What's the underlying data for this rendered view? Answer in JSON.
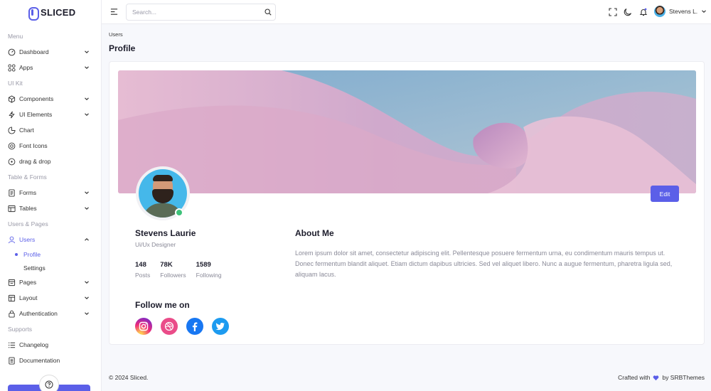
{
  "brand": {
    "name": "SLICED",
    "color": "#5b5fe8"
  },
  "sidebar": {
    "sections": [
      {
        "title": "Menu",
        "items": [
          {
            "label": "Dashboard",
            "icon": "dashboard-icon",
            "has_children": true
          },
          {
            "label": "Apps",
            "icon": "apps-icon",
            "has_children": true
          }
        ]
      },
      {
        "title": "UI Kit",
        "items": [
          {
            "label": "Components",
            "icon": "cube-icon",
            "has_children": true
          },
          {
            "label": "UI Elements",
            "icon": "bolt-icon",
            "has_children": true
          },
          {
            "label": "Chart",
            "icon": "chart-icon",
            "has_children": false
          },
          {
            "label": "Font Icons",
            "icon": "target-icon",
            "has_children": false
          },
          {
            "label": "drag & drop",
            "icon": "drag-icon",
            "has_children": false
          }
        ]
      },
      {
        "title": "Table & Forms",
        "items": [
          {
            "label": "Forms",
            "icon": "form-icon",
            "has_children": true
          },
          {
            "label": "Tables",
            "icon": "table-icon",
            "has_children": true
          }
        ]
      },
      {
        "title": "Users & Pages",
        "items": [
          {
            "label": "Users",
            "icon": "user-icon",
            "has_children": true,
            "expanded": true,
            "children": [
              {
                "label": "Profile",
                "active": true
              },
              {
                "label": "Settings",
                "active": false
              }
            ]
          },
          {
            "label": "Pages",
            "icon": "pages-icon",
            "has_children": true
          },
          {
            "label": "Layout",
            "icon": "layout-icon",
            "has_children": true
          },
          {
            "label": "Authentication",
            "icon": "lock-icon",
            "has_children": true
          }
        ]
      },
      {
        "title": "Supports",
        "items": [
          {
            "label": "Changelog",
            "icon": "list-icon",
            "has_children": false
          },
          {
            "label": "Documentation",
            "icon": "doc-icon",
            "has_children": false
          }
        ]
      }
    ]
  },
  "topbar": {
    "search_placeholder": "Search...",
    "user_name": "Stevens L."
  },
  "page": {
    "breadcrumb": "Users",
    "title": "Profile"
  },
  "profile": {
    "name": "Stevens Laurie",
    "role": "Ui/Ux Designer",
    "stats": [
      {
        "value": "148",
        "label": "Posts"
      },
      {
        "value": "78K",
        "label": "Followers"
      },
      {
        "value": "1589",
        "label": "Following"
      }
    ],
    "edit_label": "Edit",
    "follow_title": "Follow me on",
    "socials": [
      "instagram-icon",
      "dribbble-icon",
      "facebook-icon",
      "twitter-icon"
    ],
    "about_title": "About Me",
    "about_text": "Lorem ipsum dolor sit amet, consectetur adipiscing elit. Pellentesque posuere fermentum urna, eu condimentum mauris tempus ut. Donec fermentum blandit aliquet. Etiam dictum dapibus ultricies. Sed vel aliquet libero. Nunc a augue fermentum, pharetra ligula sed, aliquam lacus.",
    "status": "online"
  },
  "footer": {
    "copyright": "© 2024 Sliced.",
    "crafted_prefix": "Crafted with",
    "crafted_suffix": "by SRBThemes"
  }
}
